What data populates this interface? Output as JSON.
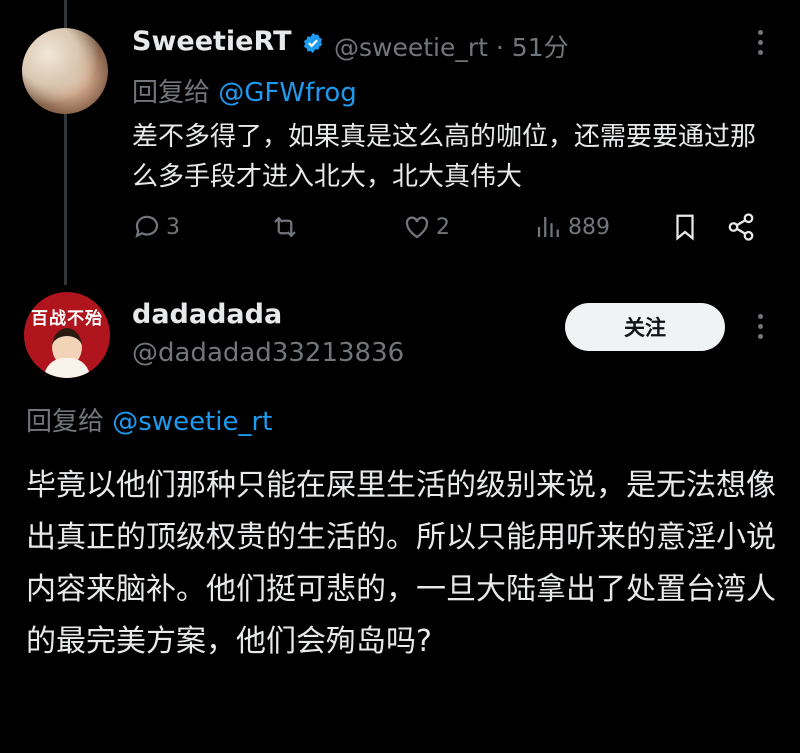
{
  "tweet1": {
    "name": "SweetieRT",
    "handle": "@sweetie_rt",
    "time": "· 51分",
    "reply_prefix": "回复给 ",
    "reply_to": "@GFWfrog",
    "text": "差不多得了，如果真是这么高的咖位，还需要要通过那么多手段才进入北大，北大真伟大",
    "actions": {
      "replies": "3",
      "retweets": "",
      "likes": "2",
      "views": "889"
    },
    "icons": [
      "reply-icon",
      "retweet-icon",
      "like-icon",
      "views-icon",
      "bookmark-icon",
      "share-icon"
    ]
  },
  "tweet2": {
    "name": "dadadada",
    "handle": "@dadadad33213836",
    "follow_label": "关注",
    "reply_prefix": "回复给 ",
    "reply_to": "@sweetie_rt",
    "text": "毕竟以他们那种只能在屎里生活的级别来说，是无法想像出真正的顶级权贵的生活的。所以只能用听来的意淫小说内容来脑补。他们挺可悲的，一旦大陆拿出了处置台湾人的最完美方案，他们会殉岛吗?",
    "avatar_text": "百战不殆"
  },
  "colors": {
    "accent": "#1d9bf0",
    "muted": "#71767b",
    "text": "#e7e9ea",
    "background": "#000000"
  }
}
